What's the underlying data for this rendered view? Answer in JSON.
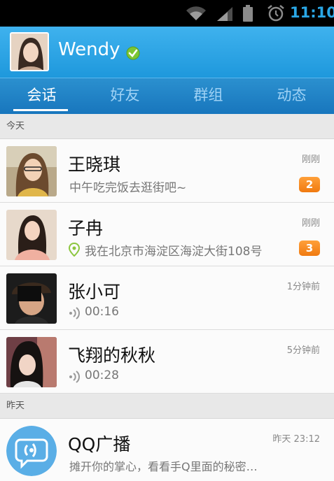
{
  "status_bar": {
    "time": "11:10"
  },
  "header": {
    "user_name": "Wendy"
  },
  "tabs": [
    {
      "label": "会话"
    },
    {
      "label": "好友"
    },
    {
      "label": "群组"
    },
    {
      "label": "动态"
    }
  ],
  "sections": {
    "today": "今天",
    "yesterday": "昨天"
  },
  "conversations": [
    {
      "name": "王晓琪",
      "message": "中午吃完饭去逛街吧~",
      "time": "刚刚",
      "unread": "2"
    },
    {
      "name": "子冉",
      "message": "我在北京市海淀区海淀大街108号",
      "time": "刚刚",
      "unread": "3"
    },
    {
      "name": "张小可",
      "message": "00:16",
      "time": "1分钟前"
    },
    {
      "name": "飞翔的秋秋",
      "message": "00:28",
      "time": "5分钟前"
    },
    {
      "name": "QQ广播",
      "message": "摊开你的掌心，看看手Q里面的秘密…",
      "time": "昨天 23:12"
    }
  ],
  "colors": {
    "header_blue": "#2ea4e8",
    "tab_blue": "#1d80c4",
    "badge_orange": "#f5841f",
    "time_cyan": "#2aa7e6"
  }
}
